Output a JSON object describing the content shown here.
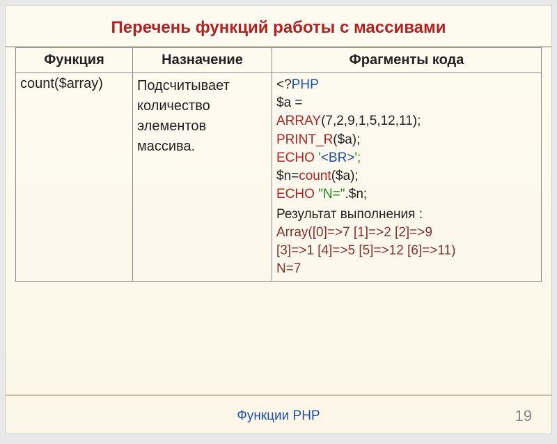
{
  "title": "Перечень функций работы с массивами",
  "table": {
    "headers": [
      "Функция",
      "Назначение",
      "Фрагменты кода"
    ],
    "row": {
      "function": "count($array)",
      "description": "Подсчитывает количество элементов массива.",
      "code": {
        "l1a": "<?",
        "l1b": "PHP",
        "l2": "$a = ",
        "l3a": "ARRAY",
        "l3b": "(7,2,9,1,5,12,11);",
        "l4a": "PRINT_R",
        "l4b": "($a);",
        "l5a": "ECHO",
        "l5b": " '",
        "l5c": "<BR>",
        "l5d": "';",
        "l6a": "$n=",
        "l6b": "count",
        "l6c": "($a);",
        "l7a": "ECHO",
        "l7b": " \"N=\"",
        "l7c": ".$n;",
        "resultLabel": "Результат выполнения :",
        "r1": "Array([0]=>7 [1]=>2 [2]=>9",
        "r2": "[3]=>1 [4]=>5 [5]=>12 [6]=>11)",
        "r3": "N=7"
      }
    }
  },
  "footer": "Функции PHP",
  "page": "19"
}
